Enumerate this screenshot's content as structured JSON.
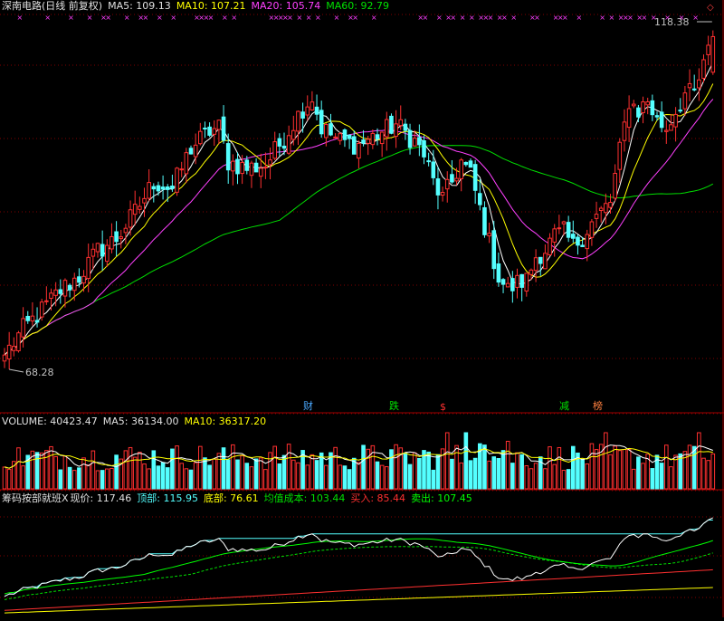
{
  "price_header": {
    "title": "深南电路(日线 前复权)",
    "ma5": "MA5: 109.13",
    "ma10": "MA10: 107.21",
    "ma20": "MA20: 105.74",
    "ma60": "MA60: 92.79"
  },
  "volume_header": {
    "title": "VOLUME: 40423.47",
    "ma5": "MA5: 36134.00",
    "ma10": "MA10: 36317.20"
  },
  "chip_header": {
    "title": "筹码按部就班X",
    "current": "现价: 117.46",
    "top": "顶部: 115.95",
    "bottom": "底部: 76.61",
    "avg_cost": "均值成本: 103.44",
    "buy": "买入: 85.44",
    "sell": "卖出: 107.45"
  },
  "annotations": {
    "high_value": "118.38",
    "low_value": "68.28"
  },
  "signals": {
    "cai": "财",
    "die": "跌",
    "dollar": "$",
    "jian": "减",
    "bang": "榜"
  },
  "colors": {
    "up": "#ff3030",
    "down": "#54ffff",
    "ma5": "#ffffff",
    "ma10": "#ffff00",
    "ma20": "#ff40ff",
    "ma60": "#00e000",
    "grid": "#800000",
    "sell_line": "#00ff00"
  },
  "chart_data": [
    {
      "type": "candlestick",
      "title": "深南电路(日线 前复权)",
      "ylim": [
        64,
        121
      ],
      "high_marker": 118.38,
      "low_marker": 68.28,
      "series": [
        {
          "name": "MA5",
          "last": 109.13
        },
        {
          "name": "MA10",
          "last": 107.21
        },
        {
          "name": "MA20",
          "last": 105.74
        },
        {
          "name": "MA60",
          "last": 92.79
        }
      ],
      "keypoints": [
        [
          0,
          70.4
        ],
        [
          4,
          74.2
        ],
        [
          8,
          77.0
        ],
        [
          12,
          80.0
        ],
        [
          16,
          82.0
        ],
        [
          20,
          85.8
        ],
        [
          24,
          87.6
        ],
        [
          28,
          91.5
        ],
        [
          32,
          96.0
        ],
        [
          36,
          95.0
        ],
        [
          40,
          101.0
        ],
        [
          44,
          103.5
        ],
        [
          46,
          104.0
        ],
        [
          48,
          99.0
        ],
        [
          52,
          98.0
        ],
        [
          56,
          98.5
        ],
        [
          60,
          102.5
        ],
        [
          64,
          107.0
        ],
        [
          66,
          108.5
        ],
        [
          68,
          104.0
        ],
        [
          72,
          102.0
        ],
        [
          76,
          101.5
        ],
        [
          80,
          103.0
        ],
        [
          84,
          104.5
        ],
        [
          88,
          102.0
        ],
        [
          90,
          100.0
        ],
        [
          92,
          96.0
        ],
        [
          94,
          93.5
        ],
        [
          96,
          96.0
        ],
        [
          98,
          99.0
        ],
        [
          100,
          97.0
        ],
        [
          102,
          92.0
        ],
        [
          104,
          87.0
        ],
        [
          106,
          82.0
        ],
        [
          108,
          80.0
        ],
        [
          110,
          81.0
        ],
        [
          112,
          81.5
        ],
        [
          114,
          85.0
        ],
        [
          116,
          86.0
        ],
        [
          118,
          88.0
        ],
        [
          120,
          88.5
        ],
        [
          122,
          86.5
        ],
        [
          124,
          88.0
        ],
        [
          126,
          90.0
        ],
        [
          128,
          91.5
        ],
        [
          130,
          93.0
        ],
        [
          132,
          100.5
        ],
        [
          134,
          108.0
        ],
        [
          136,
          106.5
        ],
        [
          138,
          108.0
        ],
        [
          140,
          105.0
        ],
        [
          142,
          104.0
        ],
        [
          144,
          106.5
        ],
        [
          146,
          109.0
        ],
        [
          148,
          109.0
        ],
        [
          150,
          113.0
        ],
        [
          152,
          117.46
        ]
      ]
    },
    {
      "type": "bar",
      "title": "VOLUME",
      "last": 40423.47,
      "series": [
        {
          "name": "MA5",
          "last": 36134.0
        },
        {
          "name": "MA10",
          "last": 36317.2
        }
      ]
    },
    {
      "type": "line",
      "title": "筹码按部就班X",
      "series": [
        {
          "name": "现价",
          "last": 117.46
        },
        {
          "name": "顶部",
          "last": 115.95
        },
        {
          "name": "底部",
          "last": 76.61
        },
        {
          "name": "均值成本",
          "last": 103.44
        },
        {
          "name": "买入",
          "last": 85.44
        },
        {
          "name": "卖出",
          "last": 107.45
        }
      ]
    }
  ]
}
